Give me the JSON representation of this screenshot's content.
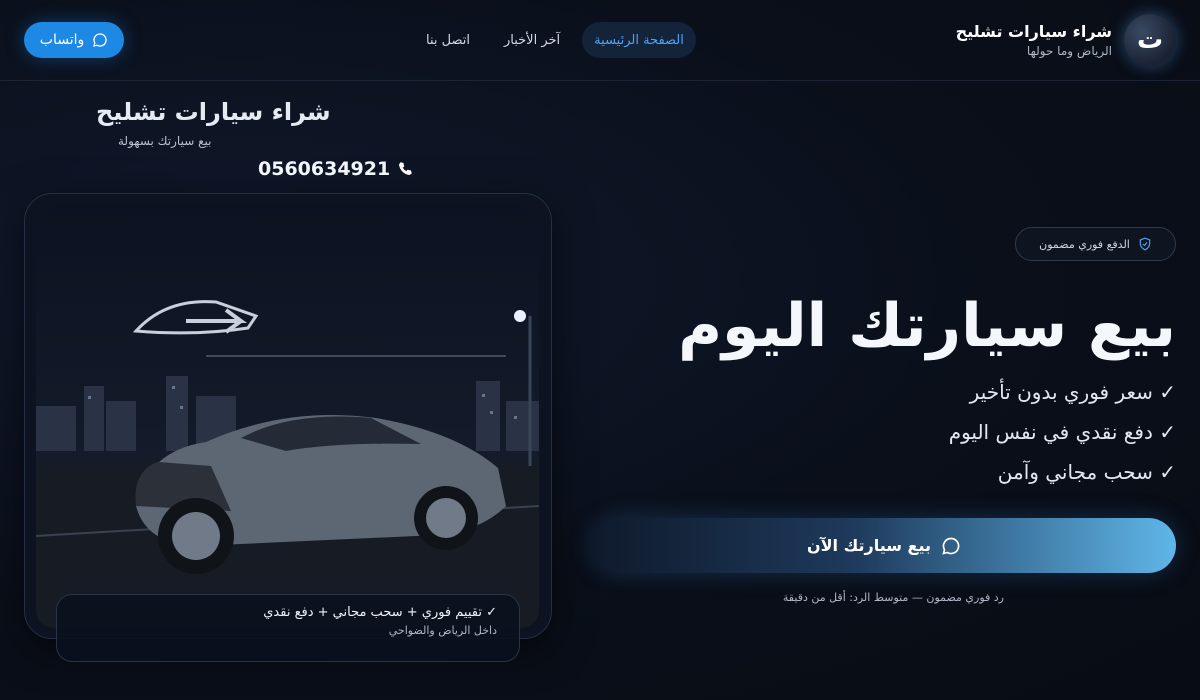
{
  "header": {
    "brand_title": "شراء سيارات تشليح",
    "brand_sub": "الرياض وما حولها",
    "logo_letter": "ت",
    "nav": [
      {
        "label": "الصفحة الرئيسية",
        "active": true
      },
      {
        "label": "آخر الأخبار",
        "active": false
      },
      {
        "label": "اتصل بنا",
        "active": false
      }
    ],
    "whatsapp_label": "واتساب"
  },
  "hero": {
    "badge": "الدفع فوري مضمون",
    "title": "بيع سيارتك اليوم",
    "features": [
      "✓ سعر فوري بدون تأخير",
      "✓ دفع نقدي في نفس اليوم",
      "✓ سحب مجاني وآمن"
    ],
    "cta_label": "بيع سيارتك الآن",
    "note": "رد فوري مضمون — متوسط الرد: أقل من دقيقة"
  },
  "image_card": {
    "title": "شراء سيارات تشليح",
    "subtitle": "بيع سيارتك بسهولة",
    "phone": "0560634921",
    "overlay_main": "✓ تقييم فوري + سحب مجاني + دفع نقدي",
    "overlay_sub": "داخل الرياض والضواحي"
  },
  "colors": {
    "accent": "#1e88e5",
    "background": "#0a0f1a",
    "nav_active": "#4fa3f5"
  },
  "icons": [
    "whatsapp-icon",
    "shield-icon",
    "chat-icon",
    "phone-icon"
  ]
}
